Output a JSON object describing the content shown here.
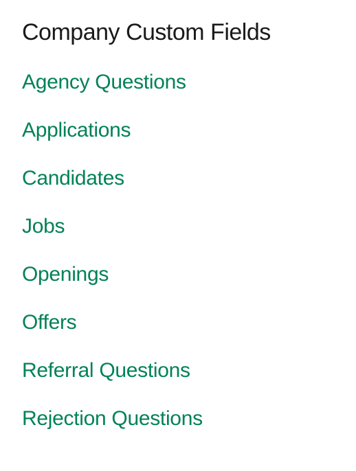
{
  "heading": "Company Custom Fields",
  "links": [
    {
      "label": "Agency Questions"
    },
    {
      "label": "Applications"
    },
    {
      "label": "Candidates"
    },
    {
      "label": "Jobs"
    },
    {
      "label": "Openings"
    },
    {
      "label": "Offers"
    },
    {
      "label": "Referral Questions"
    },
    {
      "label": "Rejection Questions"
    }
  ]
}
